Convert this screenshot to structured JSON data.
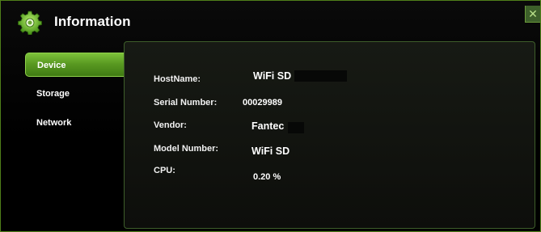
{
  "window": {
    "title": "Information",
    "close_label": "✕",
    "accent_color": "#5a9a22"
  },
  "nav": {
    "items": [
      {
        "label": "Device",
        "active": true
      },
      {
        "label": "Storage",
        "active": false
      },
      {
        "label": "Network",
        "active": false
      }
    ]
  },
  "device_info": {
    "rows": [
      {
        "label": "HostName:",
        "value": "WiFi SD"
      },
      {
        "label": "Serial Number:",
        "value": "00029989"
      },
      {
        "label": "Vendor:",
        "value": "Fantec"
      },
      {
        "label": "Model Number:",
        "value": "WiFi SD"
      },
      {
        "label": "CPU:",
        "value": "0.20 %"
      }
    ]
  }
}
